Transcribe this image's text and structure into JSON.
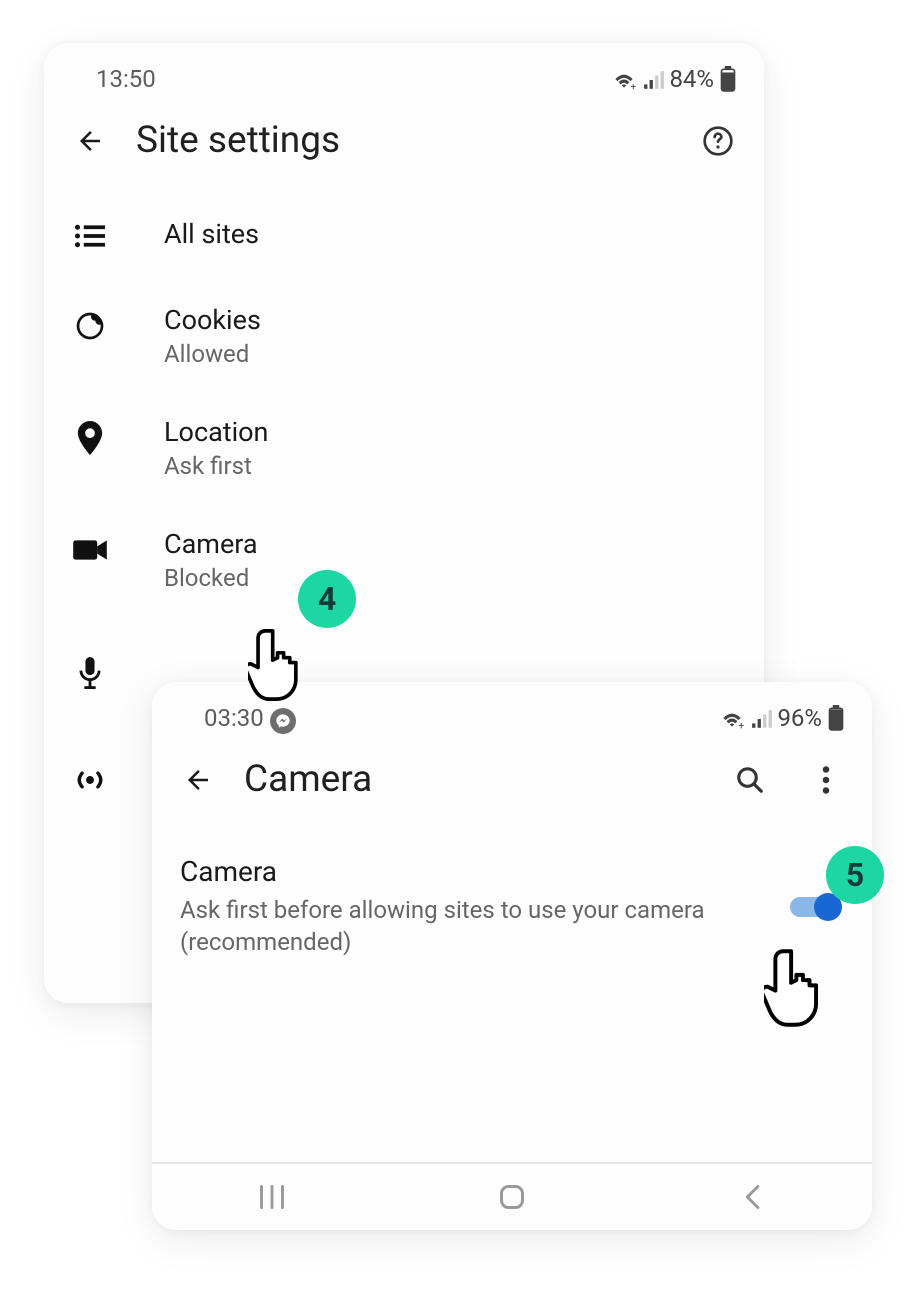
{
  "screen1": {
    "status": {
      "time": "13:50",
      "battery": "84%"
    },
    "header": {
      "title": "Site settings"
    },
    "items": [
      {
        "icon": "list-icon",
        "title": "All sites",
        "subtitle": ""
      },
      {
        "icon": "cookie-icon",
        "title": "Cookies",
        "subtitle": "Allowed"
      },
      {
        "icon": "location-icon",
        "title": "Location",
        "subtitle": "Ask first"
      },
      {
        "icon": "camera-icon",
        "title": "Camera",
        "subtitle": "Blocked"
      },
      {
        "icon": "mic-icon",
        "title": "",
        "subtitle": ""
      },
      {
        "icon": "sensors-icon",
        "title": "",
        "subtitle": ""
      }
    ]
  },
  "screen2": {
    "status": {
      "time": "03:30",
      "battery": "96%"
    },
    "header": {
      "title": "Camera"
    },
    "toggle": {
      "title": "Camera",
      "description": "Ask first before allowing sites to use your camera (recommended)",
      "enabled": true
    }
  },
  "badges": {
    "b4": "4",
    "b5": "5"
  }
}
